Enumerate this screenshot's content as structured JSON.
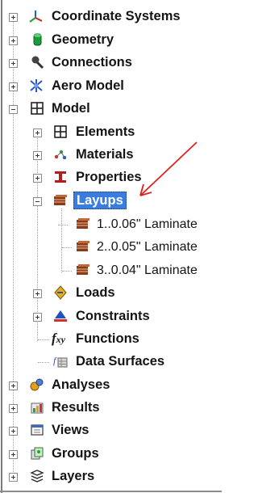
{
  "tree": {
    "items": [
      {
        "label": "Coordinate Systems",
        "icon": "coordinate-axes-icon"
      },
      {
        "label": "Geometry",
        "icon": "geometry-cylinder-icon"
      },
      {
        "label": "Connections",
        "icon": "connection-pin-icon"
      },
      {
        "label": "Aero Model",
        "icon": "aircraft-icon"
      },
      {
        "label": "Model",
        "icon": "grid-icon"
      },
      {
        "label": "Elements",
        "icon": "grid-icon"
      },
      {
        "label": "Materials",
        "icon": "materials-molecule-icon"
      },
      {
        "label": "Properties",
        "icon": "i-beam-icon"
      },
      {
        "label": "Layups",
        "icon": "layup-stack-icon"
      },
      {
        "label": "1..0.06\" Laminate",
        "icon": "layup-stack-icon"
      },
      {
        "label": "2..0.05\" Laminate",
        "icon": "layup-stack-icon"
      },
      {
        "label": "3..0.04\" Laminate",
        "icon": "layup-stack-icon"
      },
      {
        "label": "Loads",
        "icon": "load-arrow-icon"
      },
      {
        "label": "Constraints",
        "icon": "constraint-icon"
      },
      {
        "label": "Functions",
        "icon": "function-fxy-icon"
      },
      {
        "label": "Data Surfaces",
        "icon": "data-surface-icon"
      },
      {
        "label": "Analyses",
        "icon": "analysis-icon"
      },
      {
        "label": "Results",
        "icon": "results-icon"
      },
      {
        "label": "Views",
        "icon": "views-icon"
      },
      {
        "label": "Groups",
        "icon": "groups-icon"
      },
      {
        "label": "Layers",
        "icon": "layers-icon"
      }
    ],
    "fxy_glyph": "f",
    "fxy_sub": "xy"
  },
  "colors": {
    "selection": "#3a7de0",
    "annotation_arrow": "#e0201c",
    "layup_icon": "#8b3a1a"
  }
}
